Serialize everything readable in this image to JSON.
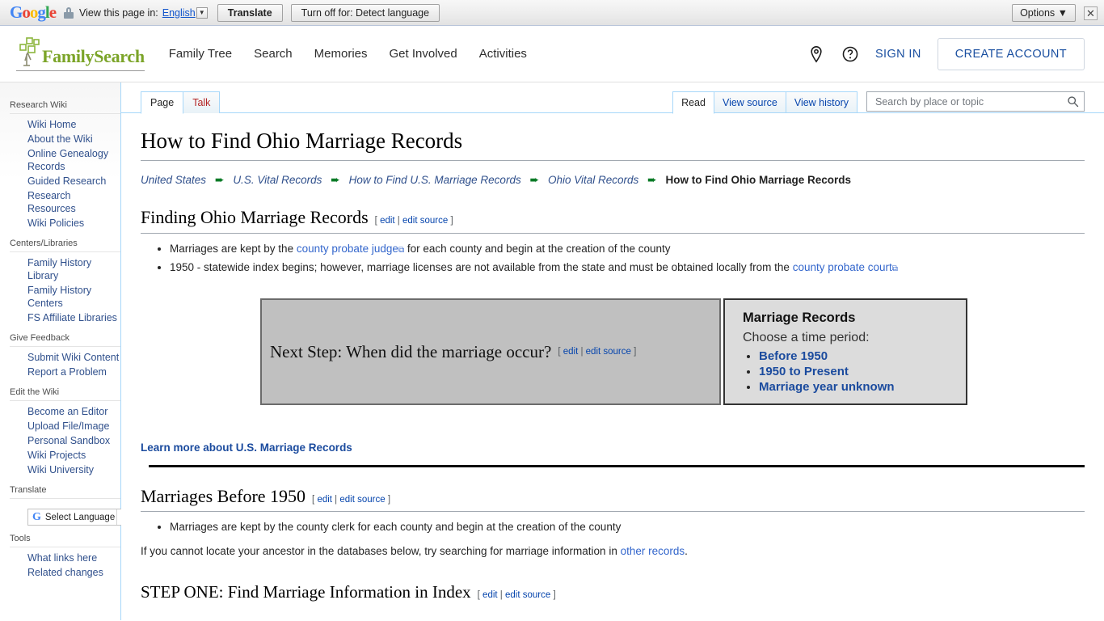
{
  "translate_bar": {
    "logo": "Google",
    "lock_icon": "lock-icon",
    "view_text": "View this page in:",
    "language": "English",
    "caret": "▼",
    "translate_button": "Translate",
    "turn_off_button": "Turn off for: Detect language",
    "options_button": "Options ▼",
    "close_button": "✕"
  },
  "header": {
    "brand": "FamilySearch",
    "nav": [
      {
        "label": "Family Tree"
      },
      {
        "label": "Search"
      },
      {
        "label": "Memories"
      },
      {
        "label": "Get Involved"
      },
      {
        "label": "Activities"
      }
    ],
    "location_icon": "map-pin-icon",
    "help_icon": "help-circle-icon",
    "sign_in": "SIGN IN",
    "create_account": "CREATE ACCOUNT",
    "brand_color": "#7ba428",
    "link_color": "#1a4fa0"
  },
  "sidebar": {
    "sections": [
      {
        "title": "Research Wiki",
        "items": [
          {
            "label": "Wiki Home"
          },
          {
            "label": "About the Wiki"
          },
          {
            "label": "Online Genealogy Records"
          },
          {
            "label": "Guided Research"
          },
          {
            "label": "Research Resources"
          },
          {
            "label": "Wiki Policies"
          }
        ]
      },
      {
        "title": "Centers/Libraries",
        "items": [
          {
            "label": "Family History Library"
          },
          {
            "label": "Family History Centers"
          },
          {
            "label": "FS Affiliate Libraries"
          }
        ]
      },
      {
        "title": "Give Feedback",
        "items": [
          {
            "label": "Submit Wiki Content"
          },
          {
            "label": "Report a Problem"
          }
        ]
      },
      {
        "title": "Edit the Wiki",
        "items": [
          {
            "label": "Become an Editor"
          },
          {
            "label": "Upload File/Image"
          },
          {
            "label": "Personal Sandbox"
          },
          {
            "label": "Wiki Projects"
          },
          {
            "label": "Wiki University"
          }
        ]
      }
    ],
    "translate": {
      "title": "Translate",
      "widget_label": "Select Language",
      "widget_icon": "google-g-icon"
    },
    "tools": {
      "title": "Tools",
      "items": [
        {
          "label": "What links here"
        },
        {
          "label": "Related changes"
        }
      ]
    }
  },
  "tabs": {
    "left": [
      {
        "label": "Page",
        "state": "active"
      },
      {
        "label": "Talk",
        "state": "new"
      }
    ],
    "right": [
      {
        "label": "Read",
        "state": "active"
      },
      {
        "label": "View source",
        "state": "normal"
      },
      {
        "label": "View history",
        "state": "normal"
      }
    ]
  },
  "search": {
    "placeholder": "Search by place or topic",
    "value": "",
    "icon": "search-icon"
  },
  "main": {
    "title": "How to Find Ohio Marriage Records",
    "breadcrumb": [
      {
        "label": "United States",
        "current": false
      },
      {
        "label": "U.S. Vital Records",
        "current": false
      },
      {
        "label": "How to Find U.S. Marriage Records",
        "current": false
      },
      {
        "label": "Ohio Vital Records",
        "current": false
      },
      {
        "label": "How to Find Ohio Marriage Records",
        "current": true
      }
    ],
    "breadcrumb_separator": "➨",
    "section1": {
      "heading": "Finding Ohio Marriage Records",
      "edit": "edit",
      "edit_source": "edit source",
      "bullets": [
        {
          "pre": "Marriages are kept by the ",
          "link": "county probate judge",
          "post": " for each county and begin at the creation of the county"
        },
        {
          "pre": "1950 - statewide index begins; however, marriage licenses are not available from the state and must be obtained locally from the ",
          "link": "county probate court",
          "post": ""
        }
      ]
    },
    "nextstep_box": {
      "title": "Next Step: When did the marriage occur?",
      "edit": "edit",
      "edit_source": "edit source"
    },
    "marriage_records_box": {
      "heading": "Marriage Records",
      "subheading": "Choose a time period:",
      "links": [
        {
          "label": "Before 1950"
        },
        {
          "label": "1950 to Present"
        },
        {
          "label": "Marriage year unknown"
        }
      ]
    },
    "learn_more": "Learn more about U.S. Marriage Records",
    "section2": {
      "heading": "Marriages Before 1950",
      "edit": "edit",
      "edit_source": "edit source",
      "bullets": [
        {
          "pre": "Marriages are kept by the county clerk for each county and begin at the creation of the county",
          "link": "",
          "post": ""
        }
      ],
      "paragraph_pre": "If you cannot locate your ancestor in the databases below, try searching for marriage information in ",
      "paragraph_link": "other records",
      "paragraph_post": "."
    },
    "section3": {
      "heading": "STEP ONE: Find Marriage Information in Index",
      "edit": "edit",
      "edit_source": "edit source"
    }
  }
}
